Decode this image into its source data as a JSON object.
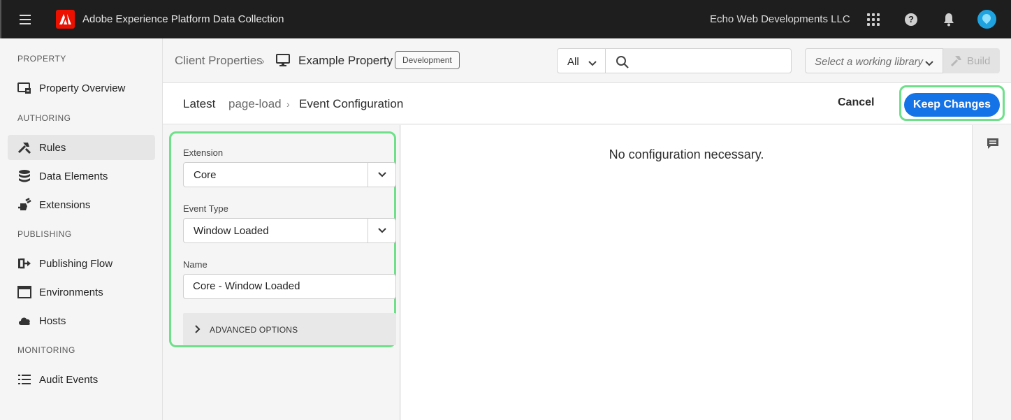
{
  "topbar": {
    "app_title": "Adobe Experience Platform Data Collection",
    "org_name": "Echo Web Developments LLC",
    "icons": [
      "menu-icon",
      "adobe-logo",
      "apps-grid-icon",
      "help-icon",
      "notifications-bell-icon",
      "user-avatar"
    ]
  },
  "sidebar": {
    "sections": [
      {
        "title": "PROPERTY",
        "items": [
          {
            "label": "Property Overview",
            "icon": "property-overview-icon"
          }
        ]
      },
      {
        "title": "AUTHORING",
        "items": [
          {
            "label": "Rules",
            "icon": "rules-icon",
            "active": true
          },
          {
            "label": "Data Elements",
            "icon": "data-elements-icon"
          },
          {
            "label": "Extensions",
            "icon": "extensions-icon"
          }
        ]
      },
      {
        "title": "PUBLISHING",
        "items": [
          {
            "label": "Publishing Flow",
            "icon": "publishing-flow-icon"
          },
          {
            "label": "Environments",
            "icon": "environments-icon"
          },
          {
            "label": "Hosts",
            "icon": "hosts-cloud-icon"
          }
        ]
      },
      {
        "title": "MONITORING",
        "items": [
          {
            "label": "Audit Events",
            "icon": "audit-events-icon"
          }
        ]
      }
    ]
  },
  "header": {
    "client_properties": "Client Properties",
    "property_name": "Example Property",
    "environment_badge": "Development",
    "filter_value": "All",
    "search_value": "",
    "library_placeholder": "Select a working library",
    "build_label": "Build"
  },
  "subheader": {
    "crumb_latest": "Latest",
    "crumb_rule": "page-load",
    "crumb_current": "Event Configuration",
    "cancel_label": "Cancel",
    "keep_label": "Keep Changes"
  },
  "config": {
    "extension_label": "Extension",
    "extension_value": "Core",
    "event_type_label": "Event Type",
    "event_type_value": "Window Loaded",
    "name_label": "Name",
    "name_value": "Core - Window Loaded",
    "advanced_label": "ADVANCED OPTIONS"
  },
  "main": {
    "message": "No configuration necessary."
  },
  "colors": {
    "accent": "#1473e6",
    "highlight": "#6ee08a",
    "topbar": "#1e1e1e",
    "adobe_red": "#eb1000"
  }
}
